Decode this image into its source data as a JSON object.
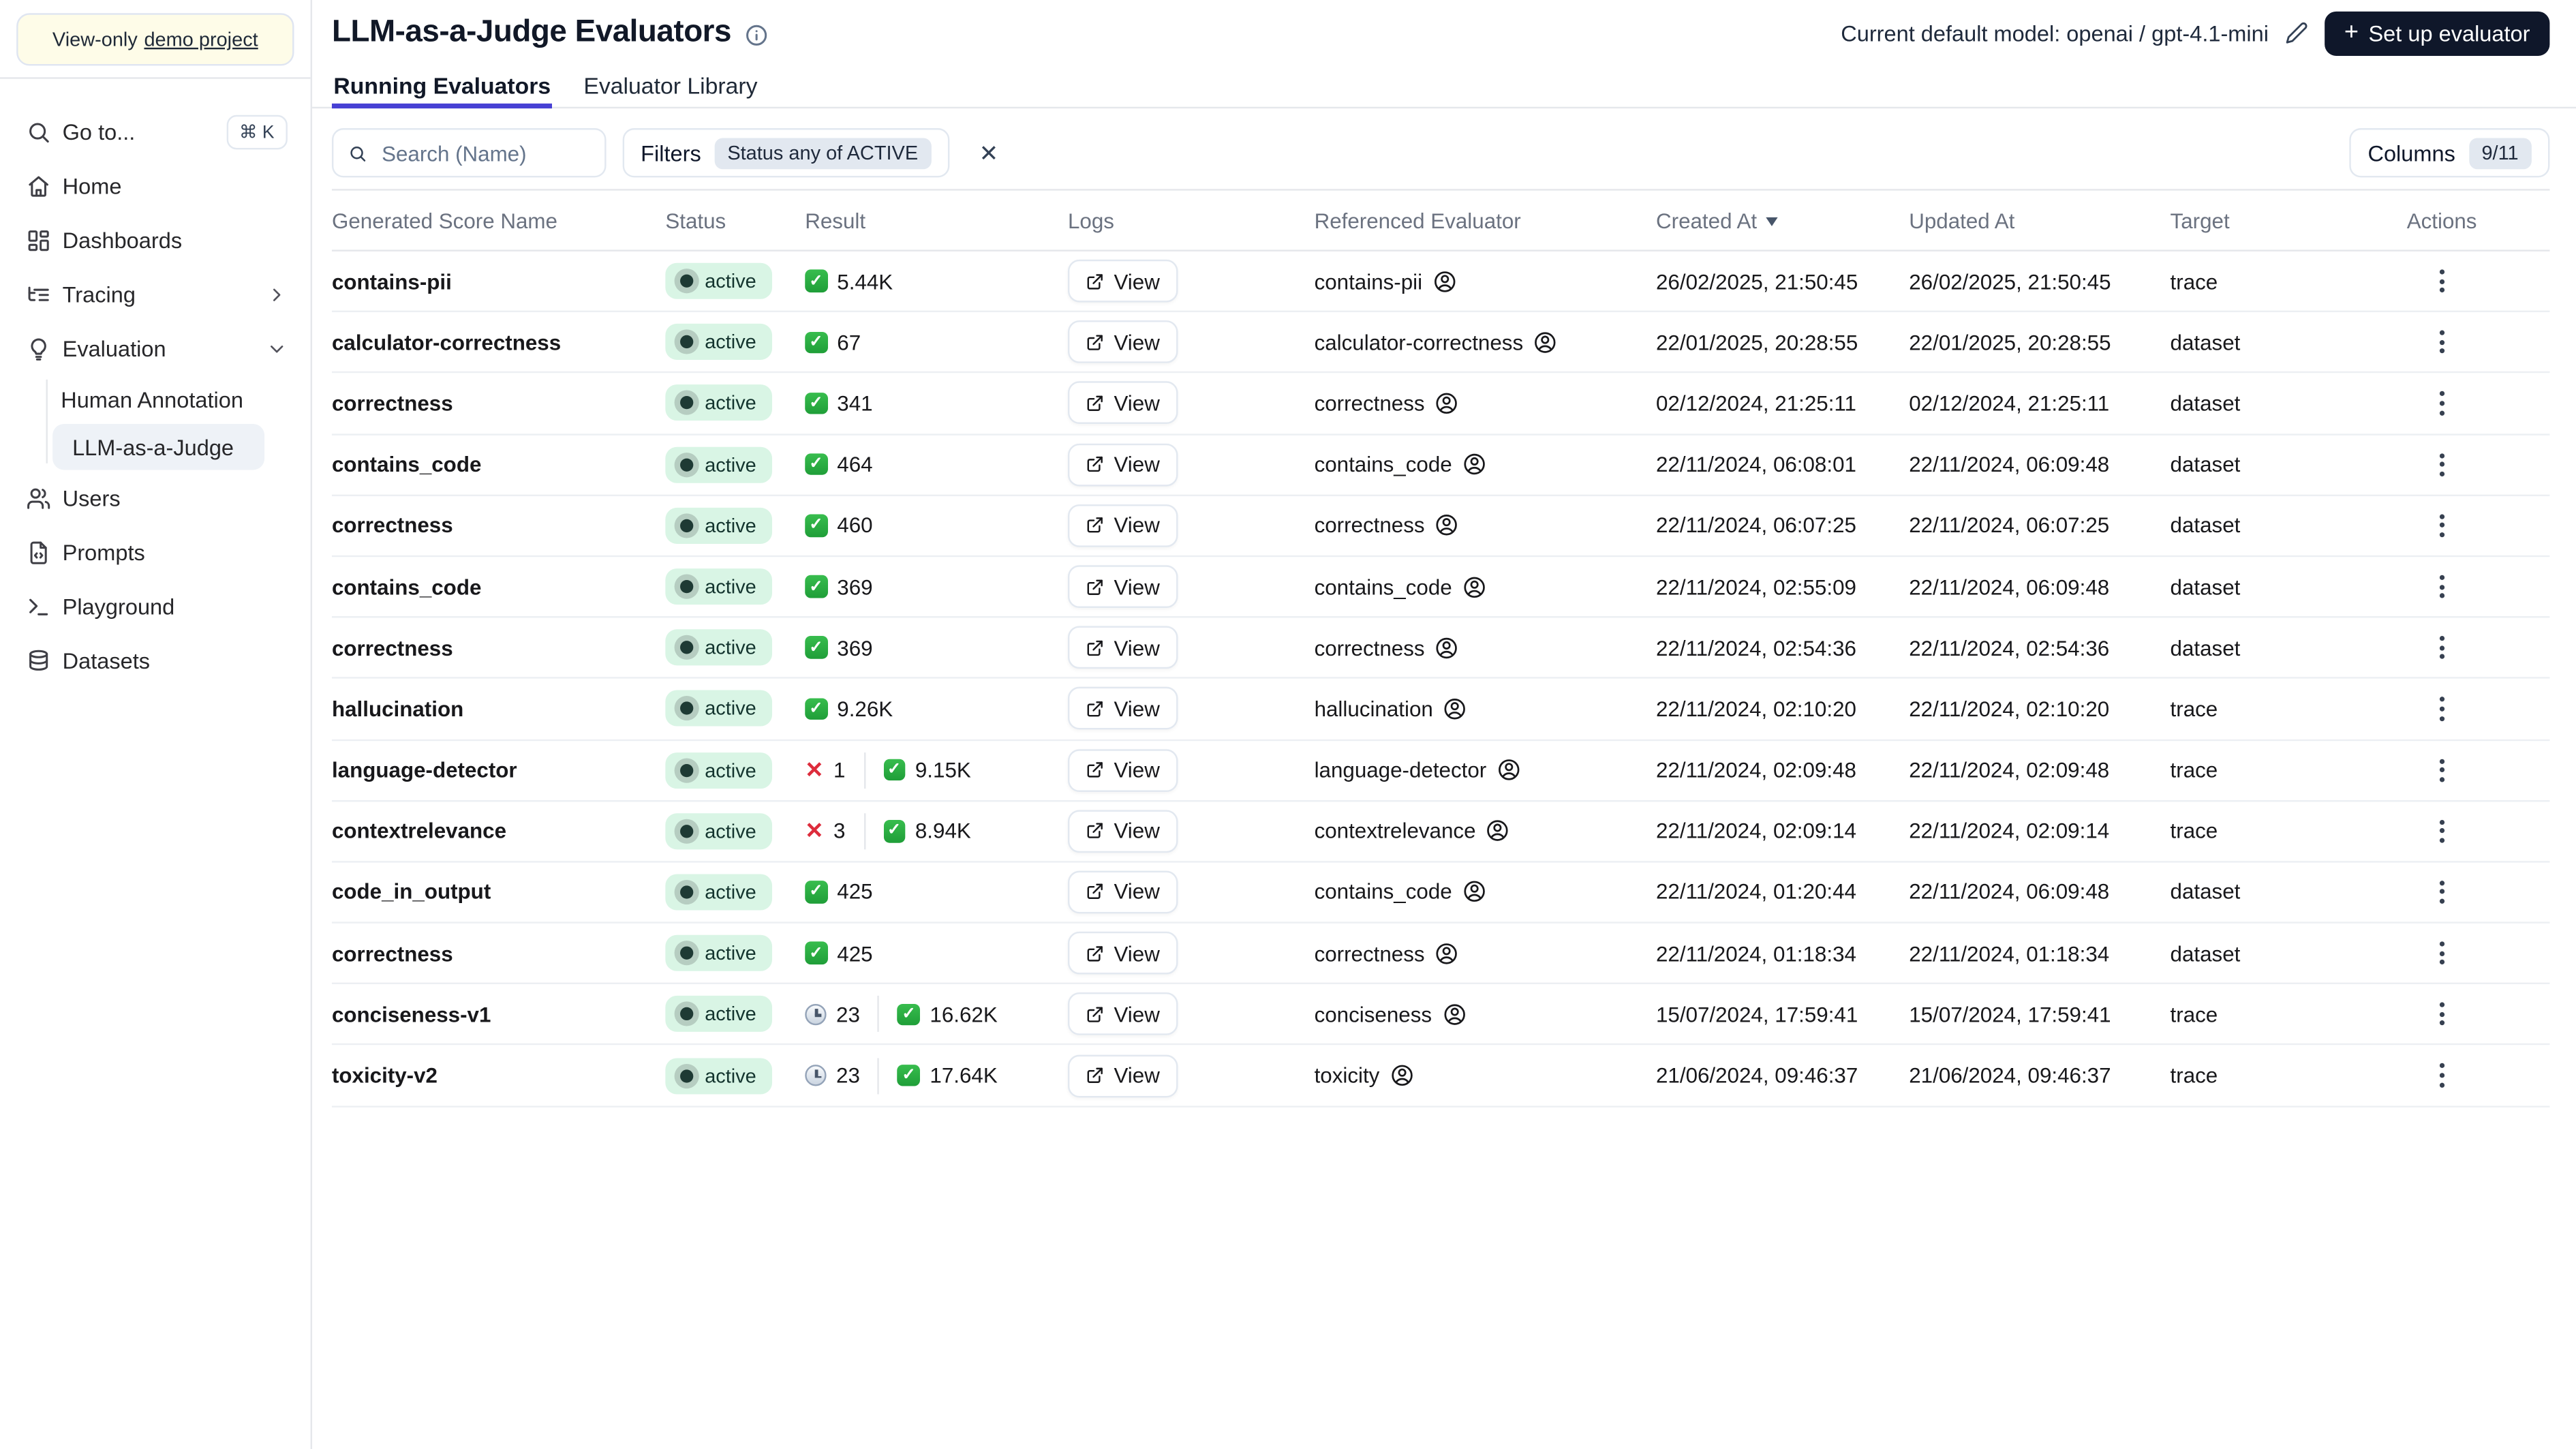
{
  "sidebar": {
    "banner": {
      "text": "View-only",
      "link_text": "demo project"
    },
    "shortcut": "⌘ K",
    "items": {
      "goto": "Go to...",
      "home": "Home",
      "dashboards": "Dashboards",
      "tracing": "Tracing",
      "evaluation": "Evaluation",
      "human_annotation": "Human Annotation",
      "llm_judge": "LLM-as-a-Judge",
      "users": "Users",
      "prompts": "Prompts",
      "playground": "Playground",
      "datasets": "Datasets"
    }
  },
  "header": {
    "title": "LLM-as-a-Judge Evaluators",
    "model_label": "Current default model: openai / gpt-4.1-mini",
    "setup_plus": "+",
    "setup_button": "Set up evaluator"
  },
  "tabs": {
    "running": "Running Evaluators",
    "library": "Evaluator Library"
  },
  "toolbar": {
    "search_placeholder": "Search (Name)",
    "filters_label": "Filters",
    "filter_chip": "Status any of ACTIVE",
    "clear_icon": "✕",
    "columns_label": "Columns",
    "columns_count": "9/11"
  },
  "table": {
    "headers": [
      "Generated Score Name",
      "Status",
      "Result",
      "Logs",
      "Referenced Evaluator",
      "Created At",
      "Updated At",
      "Target",
      "Actions"
    ],
    "sorted_by": "Created At",
    "status_colors": {
      "active_bg": "#d9f5e5",
      "active_text": "#14352f",
      "active_dot": "#1e3a34"
    },
    "accent_color": "#4740d4",
    "rows": [
      {
        "name": "contains-pii",
        "status": "active",
        "result": {
          "success": "5.44K"
        },
        "logs": "View",
        "referenced": "contains-pii",
        "created": "26/02/2025, 21:50:45",
        "updated": "26/02/2025, 21:50:45",
        "target": "trace"
      },
      {
        "name": "calculator-correctness",
        "status": "active",
        "result": {
          "success": "67"
        },
        "logs": "View",
        "referenced": "calculator-correctness",
        "created": "22/01/2025, 20:28:55",
        "updated": "22/01/2025, 20:28:55",
        "target": "dataset"
      },
      {
        "name": "correctness",
        "status": "active",
        "result": {
          "success": "341"
        },
        "logs": "View",
        "referenced": "correctness",
        "created": "02/12/2024, 21:25:11",
        "updated": "02/12/2024, 21:25:11",
        "target": "dataset"
      },
      {
        "name": "contains_code",
        "status": "active",
        "result": {
          "success": "464"
        },
        "logs": "View",
        "referenced": "contains_code",
        "created": "22/11/2024, 06:08:01",
        "updated": "22/11/2024, 06:09:48",
        "target": "dataset"
      },
      {
        "name": "correctness",
        "status": "active",
        "result": {
          "success": "460"
        },
        "logs": "View",
        "referenced": "correctness",
        "created": "22/11/2024, 06:07:25",
        "updated": "22/11/2024, 06:07:25",
        "target": "dataset"
      },
      {
        "name": "contains_code",
        "status": "active",
        "result": {
          "success": "369"
        },
        "logs": "View",
        "referenced": "contains_code",
        "created": "22/11/2024, 02:55:09",
        "updated": "22/11/2024, 06:09:48",
        "target": "dataset"
      },
      {
        "name": "correctness",
        "status": "active",
        "result": {
          "success": "369"
        },
        "logs": "View",
        "referenced": "correctness",
        "created": "22/11/2024, 02:54:36",
        "updated": "22/11/2024, 02:54:36",
        "target": "dataset"
      },
      {
        "name": "hallucination",
        "status": "active",
        "result": {
          "success": "9.26K"
        },
        "logs": "View",
        "referenced": "hallucination",
        "created": "22/11/2024, 02:10:20",
        "updated": "22/11/2024, 02:10:20",
        "target": "trace"
      },
      {
        "name": "language-detector",
        "status": "active",
        "result": {
          "error": "1",
          "success": "9.15K"
        },
        "logs": "View",
        "referenced": "language-detector",
        "created": "22/11/2024, 02:09:48",
        "updated": "22/11/2024, 02:09:48",
        "target": "trace"
      },
      {
        "name": "contextrelevance",
        "status": "active",
        "result": {
          "error": "3",
          "success": "8.94K"
        },
        "logs": "View",
        "referenced": "contextrelevance",
        "created": "22/11/2024, 02:09:14",
        "updated": "22/11/2024, 02:09:14",
        "target": "trace"
      },
      {
        "name": "code_in_output",
        "status": "active",
        "result": {
          "success": "425"
        },
        "logs": "View",
        "referenced": "contains_code",
        "created": "22/11/2024, 01:20:44",
        "updated": "22/11/2024, 06:09:48",
        "target": "dataset"
      },
      {
        "name": "correctness",
        "status": "active",
        "result": {
          "success": "425"
        },
        "logs": "View",
        "referenced": "correctness",
        "created": "22/11/2024, 01:18:34",
        "updated": "22/11/2024, 01:18:34",
        "target": "dataset"
      },
      {
        "name": "conciseness-v1",
        "status": "active",
        "result": {
          "pending": "23",
          "success": "16.62K"
        },
        "logs": "View",
        "referenced": "conciseness",
        "created": "15/07/2024, 17:59:41",
        "updated": "15/07/2024, 17:59:41",
        "target": "trace"
      },
      {
        "name": "toxicity-v2",
        "status": "active",
        "result": {
          "pending": "23",
          "success": "17.64K"
        },
        "logs": "View",
        "referenced": "toxicity",
        "created": "21/06/2024, 09:46:37",
        "updated": "21/06/2024, 09:46:37",
        "target": "trace"
      }
    ]
  }
}
